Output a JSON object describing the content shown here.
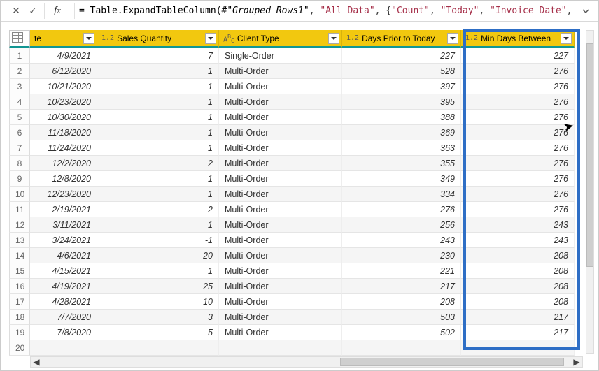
{
  "formula_bar": {
    "prefix": "= Table.ExpandTableColumn(",
    "ref": "#\"Grouped Rows1\"",
    "args": [
      ", ",
      "\"All Data\"",
      ", {",
      "\"Count\"",
      ", ",
      "\"Today\"",
      ", ",
      "\"Invoice Date\"",
      ","
    ]
  },
  "columns": {
    "date": {
      "label": "te",
      "type_tag": ""
    },
    "qty": {
      "label": "Sales Quantity",
      "type_tag": "1.2"
    },
    "type": {
      "label": "Client Type",
      "type_tag": "ABC"
    },
    "days": {
      "label": "Days Prior to Today",
      "type_tag": "1.2"
    },
    "min": {
      "label": "Min Days Between",
      "type_tag": "1.2"
    }
  },
  "rows": [
    {
      "n": 1,
      "date": "4/9/2021",
      "qty": 7,
      "type": "Single-Order",
      "days": 227,
      "min": 227
    },
    {
      "n": 2,
      "date": "6/12/2020",
      "qty": 1,
      "type": "Multi-Order",
      "days": 528,
      "min": 276
    },
    {
      "n": 3,
      "date": "10/21/2020",
      "qty": 1,
      "type": "Multi-Order",
      "days": 397,
      "min": 276
    },
    {
      "n": 4,
      "date": "10/23/2020",
      "qty": 1,
      "type": "Multi-Order",
      "days": 395,
      "min": 276
    },
    {
      "n": 5,
      "date": "10/30/2020",
      "qty": 1,
      "type": "Multi-Order",
      "days": 388,
      "min": 276
    },
    {
      "n": 6,
      "date": "11/18/2020",
      "qty": 1,
      "type": "Multi-Order",
      "days": 369,
      "min": 276
    },
    {
      "n": 7,
      "date": "11/24/2020",
      "qty": 1,
      "type": "Multi-Order",
      "days": 363,
      "min": 276
    },
    {
      "n": 8,
      "date": "12/2/2020",
      "qty": 2,
      "type": "Multi-Order",
      "days": 355,
      "min": 276
    },
    {
      "n": 9,
      "date": "12/8/2020",
      "qty": 1,
      "type": "Multi-Order",
      "days": 349,
      "min": 276
    },
    {
      "n": 10,
      "date": "12/23/2020",
      "qty": 1,
      "type": "Multi-Order",
      "days": 334,
      "min": 276
    },
    {
      "n": 11,
      "date": "2/19/2021",
      "qty": -2,
      "type": "Multi-Order",
      "days": 276,
      "min": 276
    },
    {
      "n": 12,
      "date": "3/11/2021",
      "qty": 1,
      "type": "Multi-Order",
      "days": 256,
      "min": 243
    },
    {
      "n": 13,
      "date": "3/24/2021",
      "qty": -1,
      "type": "Multi-Order",
      "days": 243,
      "min": 243
    },
    {
      "n": 14,
      "date": "4/6/2021",
      "qty": 20,
      "type": "Multi-Order",
      "days": 230,
      "min": 208
    },
    {
      "n": 15,
      "date": "4/15/2021",
      "qty": 1,
      "type": "Multi-Order",
      "days": 221,
      "min": 208
    },
    {
      "n": 16,
      "date": "4/19/2021",
      "qty": 25,
      "type": "Multi-Order",
      "days": 217,
      "min": 208
    },
    {
      "n": 17,
      "date": "4/28/2021",
      "qty": 10,
      "type": "Multi-Order",
      "days": 208,
      "min": 208
    },
    {
      "n": 18,
      "date": "7/7/2020",
      "qty": 3,
      "type": "Multi-Order",
      "days": 503,
      "min": 217
    },
    {
      "n": 19,
      "date": "7/8/2020",
      "qty": 5,
      "type": "Multi-Order",
      "days": 502,
      "min": 217
    }
  ],
  "empty_row_index": 20,
  "chart_data": {
    "type": "table",
    "columns": [
      "te",
      "Sales Quantity",
      "Client Type",
      "Days Prior to Today",
      "Min Days Between"
    ],
    "rows": [
      [
        "4/9/2021",
        7,
        "Single-Order",
        227,
        227
      ],
      [
        "6/12/2020",
        1,
        "Multi-Order",
        528,
        276
      ],
      [
        "10/21/2020",
        1,
        "Multi-Order",
        397,
        276
      ],
      [
        "10/23/2020",
        1,
        "Multi-Order",
        395,
        276
      ],
      [
        "10/30/2020",
        1,
        "Multi-Order",
        388,
        276
      ],
      [
        "11/18/2020",
        1,
        "Multi-Order",
        369,
        276
      ],
      [
        "11/24/2020",
        1,
        "Multi-Order",
        363,
        276
      ],
      [
        "12/2/2020",
        2,
        "Multi-Order",
        355,
        276
      ],
      [
        "12/8/2020",
        1,
        "Multi-Order",
        349,
        276
      ],
      [
        "12/23/2020",
        1,
        "Multi-Order",
        334,
        276
      ],
      [
        "2/19/2021",
        -2,
        "Multi-Order",
        276,
        276
      ],
      [
        "3/11/2021",
        1,
        "Multi-Order",
        256,
        243
      ],
      [
        "3/24/2021",
        -1,
        "Multi-Order",
        243,
        243
      ],
      [
        "4/6/2021",
        20,
        "Multi-Order",
        230,
        208
      ],
      [
        "4/15/2021",
        1,
        "Multi-Order",
        221,
        208
      ],
      [
        "4/19/2021",
        25,
        "Multi-Order",
        217,
        208
      ],
      [
        "4/28/2021",
        10,
        "Multi-Order",
        208,
        208
      ],
      [
        "7/7/2020",
        3,
        "Multi-Order",
        503,
        217
      ],
      [
        "7/8/2020",
        5,
        "Multi-Order",
        502,
        217
      ]
    ]
  }
}
